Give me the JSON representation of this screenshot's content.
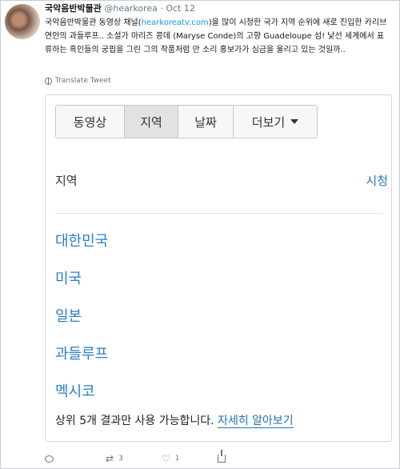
{
  "tweet": {
    "display_name": "국악음반박물관",
    "handle": "@hearkorea",
    "separator": "·",
    "date": "Oct 12",
    "text_part1": "국악음반박물관 동영상 채널(",
    "text_link": "hearkoreatv.com",
    "text_part2": ")을 많이 시청한 국가 지역 순위에 새로 진입한 카리브 연안의 과들루프.. 소설가 마리즈 콩데 (Maryse Conde)의 고향 Guadeloupe 섬! 낯선 세계에서 표류하는 흑인들의 궁핍을 그린 그의 작품처럼 만 소리 홍보가가 심금을 울리고 있는 것일까..",
    "translate_label": "Translate Tweet"
  },
  "card": {
    "tabs": [
      {
        "label": "동영상"
      },
      {
        "label": "지역"
      },
      {
        "label": "날짜"
      },
      {
        "label": "더보기"
      }
    ],
    "column_left": "지역",
    "column_right": "시청",
    "regions": [
      "대한민국",
      "미국",
      "일본",
      "과들루프",
      "멕시코"
    ],
    "footer_text": "상위 5개 결과만 사용 가능합니다.",
    "footer_link": "자세히 알아보기"
  },
  "actions": {
    "retweets": "3",
    "likes": "1"
  },
  "colors": {
    "link": "#1b95e0",
    "region_link": "#2a7ec7",
    "active_tab": "#e2e2e2"
  }
}
